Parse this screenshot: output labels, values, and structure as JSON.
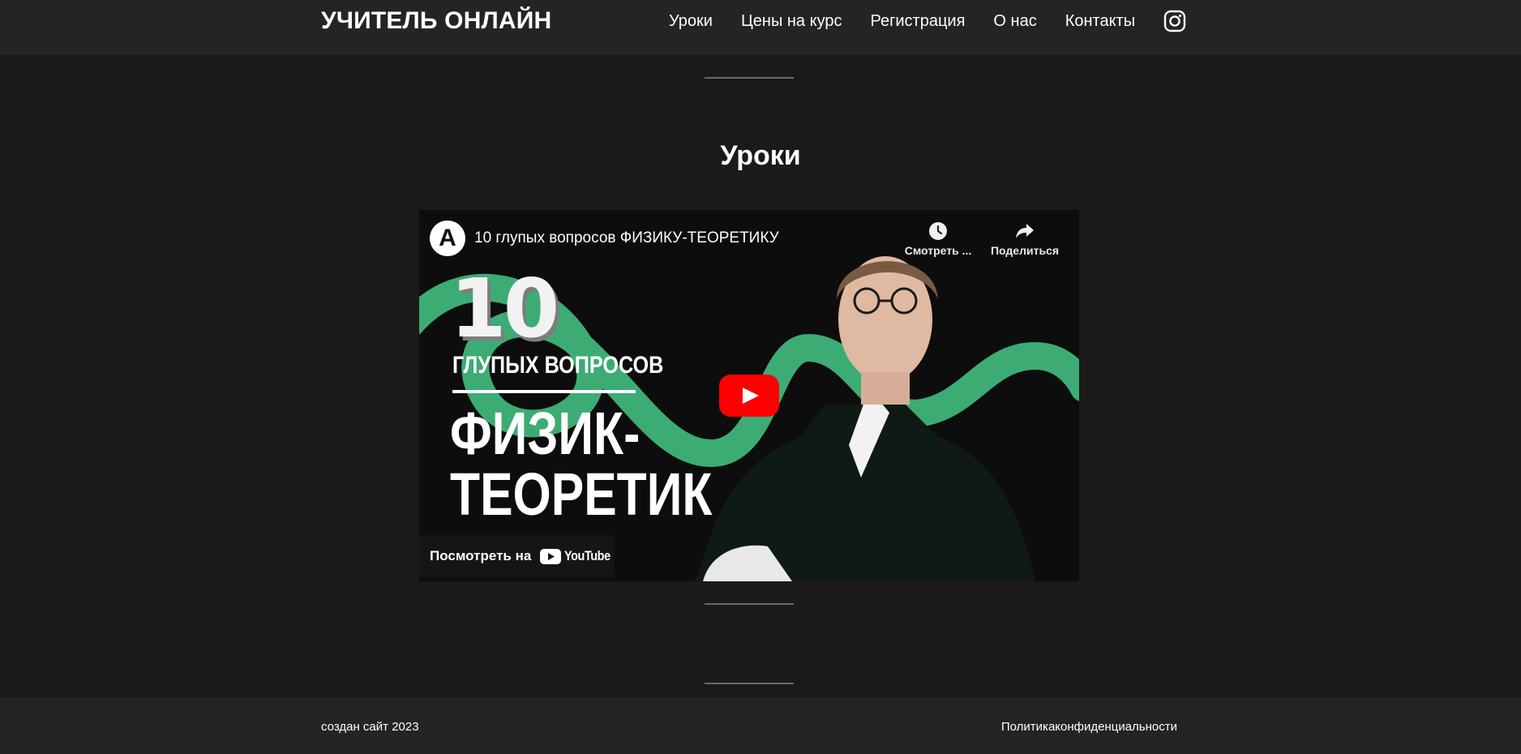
{
  "header": {
    "brand": "УЧИТЕЛЬ ОНЛАЙН",
    "nav": [
      "Уроки",
      "Цены на курс",
      "Регистрация",
      "О нас",
      "Контакты"
    ],
    "social_icon": "instagram-icon"
  },
  "section": {
    "title": "Уроки"
  },
  "video": {
    "title": "10 глупых вопросов ФИЗИКУ-ТЕОРЕТИКУ",
    "channel_logo_letter": "A",
    "watch_later_label": "Смотреть ...",
    "share_label": "Поделиться",
    "thumbnail": {
      "number": "10",
      "line1": "ГЛУПЫХ ВОПРОСОВ",
      "line2": "ФИЗИК-",
      "line3": "ТЕОРЕТИК"
    },
    "watch_on_label": "Посмотреть на",
    "youtube_label": "YouTube",
    "colors": {
      "accent_green": "#3fb57a",
      "play_red": "#ff0000"
    }
  },
  "footer": {
    "left": "создан сайт 2023",
    "right": "Политикаконфиденциальности"
  }
}
